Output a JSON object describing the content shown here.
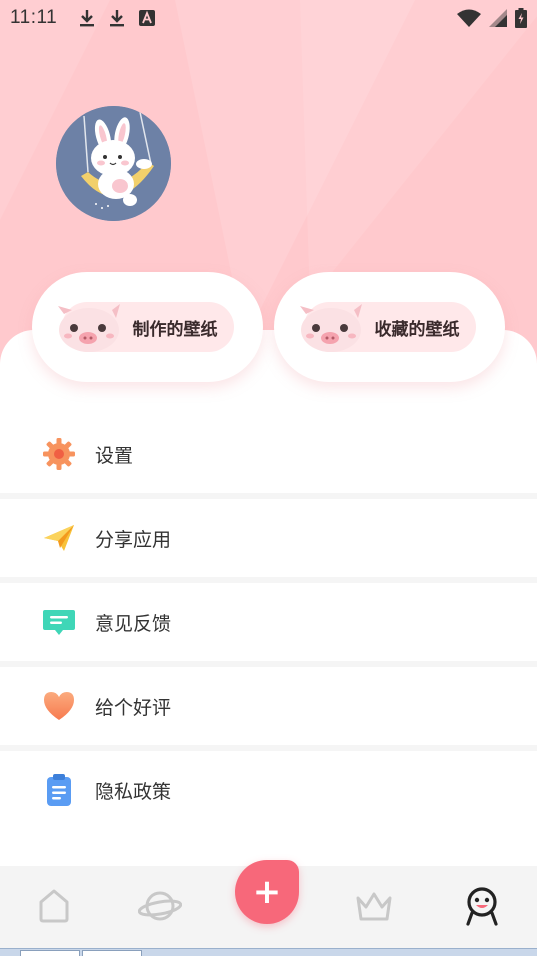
{
  "status_bar": {
    "time": "11:11",
    "left_icons": [
      "download-icon",
      "download-icon",
      "text-icon"
    ],
    "right_icons": [
      "wifi-icon",
      "signal-icon",
      "battery-icon"
    ]
  },
  "profile": {
    "avatar_icon": "bunny-avatar"
  },
  "quick_actions": [
    {
      "label": "制作的壁纸",
      "icon": "pig-icon"
    },
    {
      "label": "收藏的壁纸",
      "icon": "pig-icon"
    }
  ],
  "menu": [
    {
      "label": "设置",
      "icon": "gear-icon",
      "color": "#f78a5a"
    },
    {
      "label": "分享应用",
      "icon": "paper-plane-icon",
      "color": "#f7b32b"
    },
    {
      "label": "意见反馈",
      "icon": "message-icon",
      "color": "#3fd6b7"
    },
    {
      "label": "给个好评",
      "icon": "heart-icon",
      "color": "#f7875e"
    },
    {
      "label": "隐私政策",
      "icon": "clipboard-icon",
      "color": "#5a9cf3"
    }
  ],
  "bottom_nav": {
    "items": [
      "home-icon",
      "planet-icon",
      "add-icon",
      "crown-icon",
      "profile-icon"
    ],
    "active": "profile-icon",
    "fab_label": "+",
    "fab_color": "#f7687a"
  },
  "colors": {
    "header_bg": "#ffc9cd",
    "accent": "#f7687a"
  }
}
